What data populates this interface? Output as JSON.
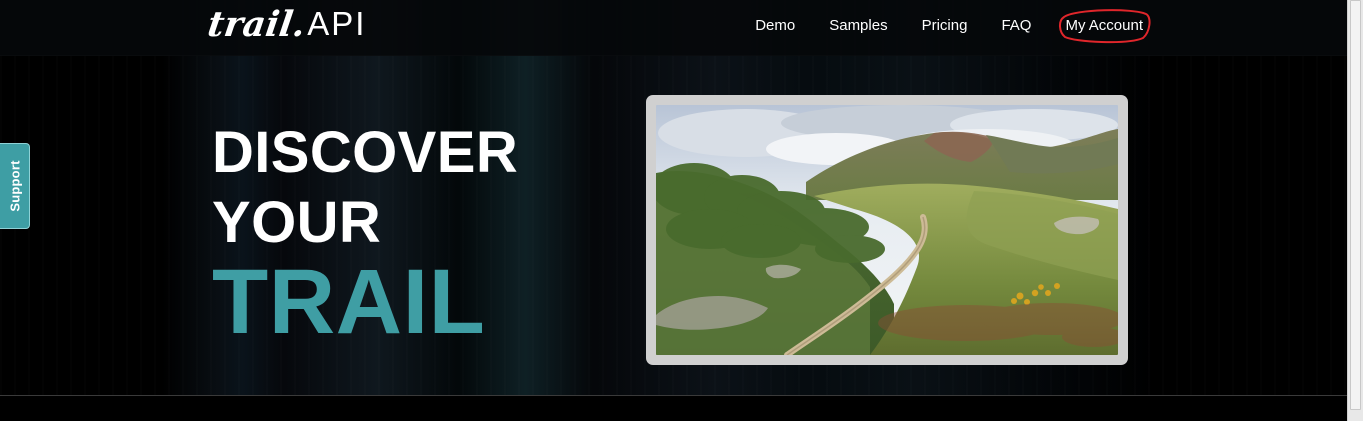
{
  "header": {
    "logo_script": "trail.",
    "logo_api": "API",
    "nav": [
      {
        "label": "Demo"
      },
      {
        "label": "Samples"
      },
      {
        "label": "Pricing"
      },
      {
        "label": "FAQ"
      },
      {
        "label": "My Account"
      }
    ]
  },
  "support": {
    "label": "Support"
  },
  "hero": {
    "line1": "DISCOVER",
    "line2": "YOUR",
    "line3": "TRAIL"
  },
  "colors": {
    "accent": "#3f9ea4",
    "annotation": "#e0262b"
  },
  "icons": {
    "support_tab": "support-tab"
  }
}
